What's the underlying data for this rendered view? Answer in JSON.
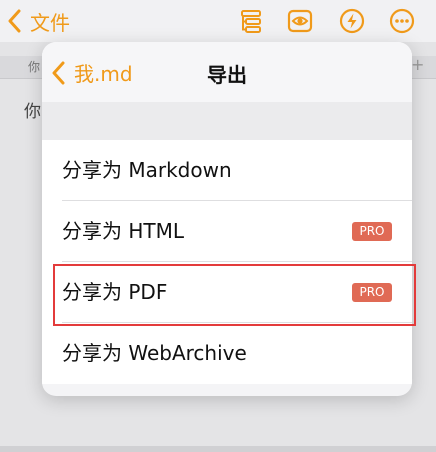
{
  "header": {
    "back_label": "文件",
    "icons": [
      "outline-icon",
      "preview-eye-icon",
      "lightning-icon",
      "more-icon"
    ],
    "accent": "#f09a1a"
  },
  "editor": {
    "tab_text": "你",
    "tab_add": "+",
    "body_text": "你"
  },
  "popover": {
    "back_label": "我.md",
    "title": "导出",
    "items": [
      {
        "label": "分享为 Markdown",
        "badge": ""
      },
      {
        "label": "分享为 HTML",
        "badge": "PRO"
      },
      {
        "label": "分享为 PDF",
        "badge": "PRO"
      },
      {
        "label": "分享为 WebArchive",
        "badge": ""
      }
    ]
  },
  "colors": {
    "badge": "#e06a55",
    "highlight": "#e33b3b"
  }
}
